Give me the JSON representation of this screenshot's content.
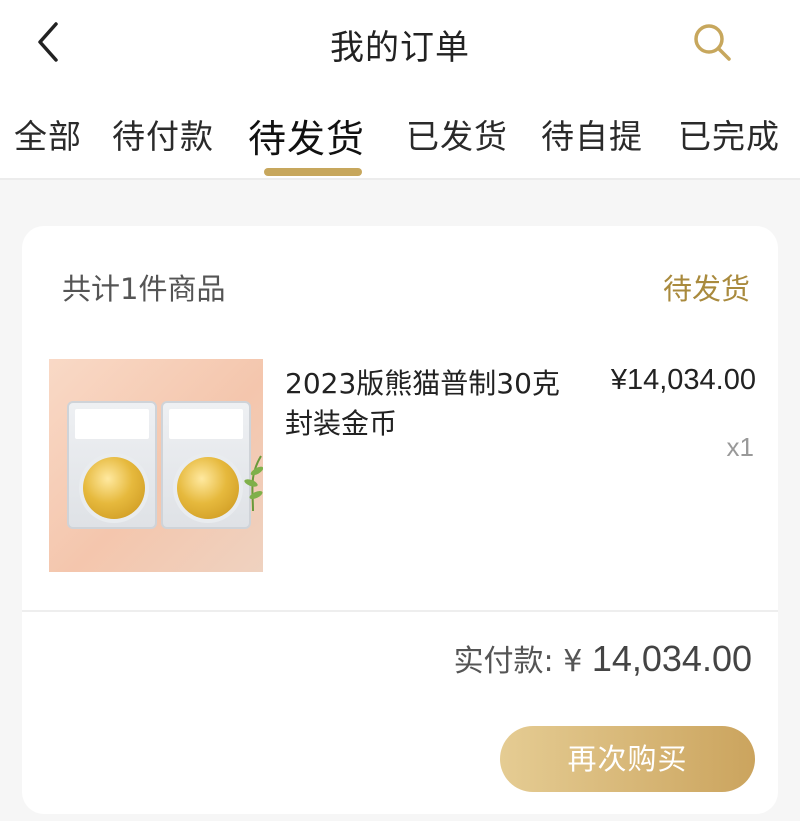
{
  "header": {
    "title": "我的订单",
    "back_icon": "chevron-left-icon",
    "search_icon": "search-icon",
    "accent_color": "#c7a75d"
  },
  "tabs": [
    {
      "label": "全部"
    },
    {
      "label": "待付款"
    },
    {
      "label": "待发货",
      "active": true
    },
    {
      "label": "已发货"
    },
    {
      "label": "待自提"
    },
    {
      "label": "已完成"
    }
  ],
  "order": {
    "count_text": "共计1件商品",
    "status": "待发货",
    "item": {
      "name": "2023版熊猫普制30克封装金币",
      "price": "¥14,034.00",
      "quantity": "x1"
    },
    "paid_label": "实付款: ¥",
    "paid_amount": "14,034.00",
    "rebuy_label": "再次购买"
  }
}
